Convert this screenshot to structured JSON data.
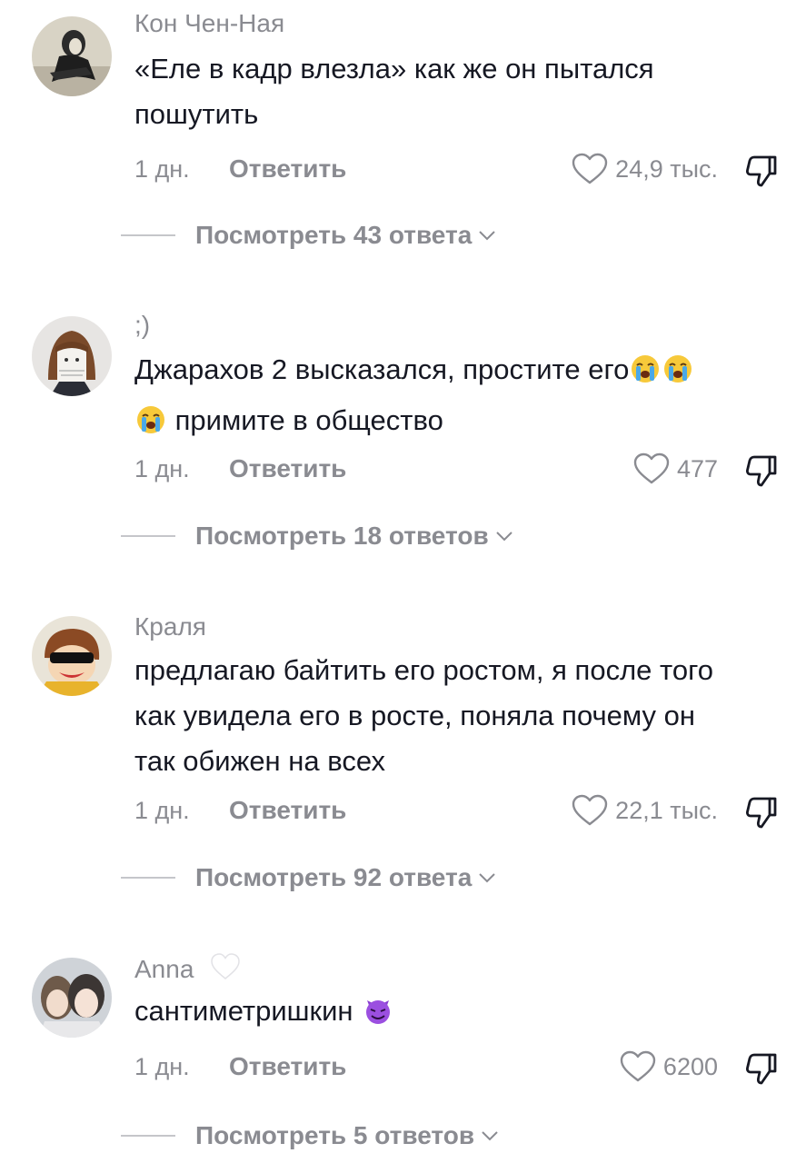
{
  "comments": [
    {
      "username": "Кон Чен-Ная",
      "text_lines": [
        "«Еле в кадр влезла» как же он пытался",
        "пошутить"
      ],
      "date": "1 дн.",
      "reply_label": "Ответить",
      "likes": "24,9 тыс.",
      "view_replies": "Посмотреть 43 ответа"
    },
    {
      "username": ";)",
      "text_line1": "Джарахов 2 высказался, простите его",
      "text_line2": "примите в общество",
      "emojis": [
        "loudly-crying-face",
        "loudly-crying-face",
        "loudly-crying-face"
      ],
      "date": "1 дн.",
      "reply_label": "Ответить",
      "likes": "477",
      "view_replies": "Посмотреть 18 ответов"
    },
    {
      "username": "Краля",
      "text_lines": [
        "предлагаю байтить его ростом, я после того",
        "как увидела его в росте, поняла почему он",
        "так обижен на всех"
      ],
      "date": "1 дн.",
      "reply_label": "Ответить",
      "likes": "22,1 тыс.",
      "view_replies": "Посмотреть 92 ответа"
    },
    {
      "username": "Anna",
      "username_emoji": "white-heart",
      "text": "сантиметришкин",
      "text_emoji": "smiling-face-with-horns",
      "date": "1 дн.",
      "reply_label": "Ответить",
      "likes": "6200",
      "view_replies": "Посмотреть 5 ответов"
    }
  ],
  "colors": {
    "text": "#161823",
    "secondary": "#8a8b91",
    "divider": "#c5c6ca",
    "background": "#ffffff"
  }
}
